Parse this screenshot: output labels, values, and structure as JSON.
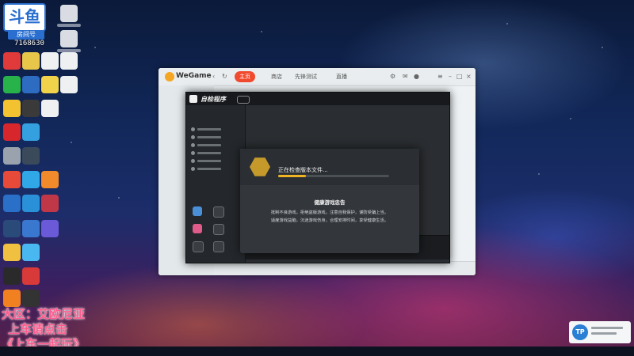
{
  "stream_badge": {
    "logo_text": "斗鱼",
    "room_label": "房间号",
    "room_number": "7168630"
  },
  "caption": {
    "line1": "大区：艾欧尼亚",
    "line2": "上车请点击",
    "line3": "《上车一起玩》"
  },
  "wegame": {
    "title": "WeGame",
    "nav": [
      "主页",
      "商店",
      "先锋测试",
      "直播"
    ]
  },
  "launcher": {
    "title": "自检程序"
  },
  "check_dialog": {
    "status_text": "正在检查版本文件...",
    "progress": 0.25,
    "health_title": "健康游戏忠告",
    "health_lines": [
      "抵制不良游戏，拒绝盗版游戏。注意自我保护，谨防受骗上当。",
      "适度游戏益脑，沉迷游戏伤身。合理安排时间，享受健康生活。"
    ]
  },
  "tray_popup": {
    "logo_text": "TP"
  },
  "colors": {
    "accent_orange": "#f04b2f",
    "progress_yellow": "#f0b323",
    "caption_pink": "#ff5a8c",
    "douyu_blue": "#2a6fd0"
  }
}
